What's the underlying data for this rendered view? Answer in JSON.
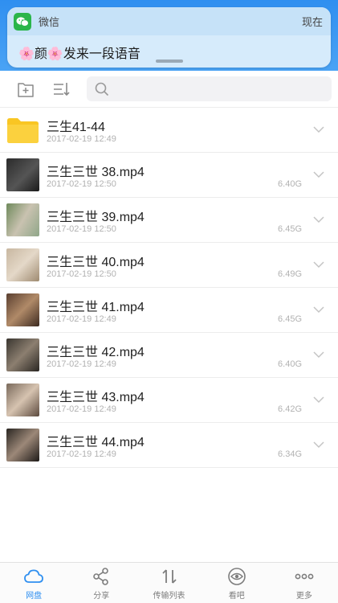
{
  "notification": {
    "app_name": "微信",
    "time": "现在",
    "message": "🌸颜🌸发来一段语音",
    "app_icon": "wechat-icon"
  },
  "toolbar": {
    "new_folder_icon": "add-folder-icon",
    "sort_icon": "sort-icon",
    "search_placeholder": ""
  },
  "files": [
    {
      "name": "三生41-44",
      "date": "2017-02-19 12:49",
      "size": "",
      "type": "folder"
    },
    {
      "name": "三生三世 38.mp4",
      "date": "2017-02-19 12:50",
      "size": "6.40G",
      "type": "video"
    },
    {
      "name": "三生三世 39.mp4",
      "date": "2017-02-19 12:50",
      "size": "6.45G",
      "type": "video"
    },
    {
      "name": "三生三世 40.mp4",
      "date": "2017-02-19 12:50",
      "size": "6.49G",
      "type": "video"
    },
    {
      "name": "三生三世 41.mp4",
      "date": "2017-02-19 12:49",
      "size": "6.45G",
      "type": "video"
    },
    {
      "name": "三生三世 42.mp4",
      "date": "2017-02-19 12:49",
      "size": "6.40G",
      "type": "video"
    },
    {
      "name": "三生三世 43.mp4",
      "date": "2017-02-19 12:49",
      "size": "6.42G",
      "type": "video"
    },
    {
      "name": "三生三世 44.mp4",
      "date": "2017-02-19 12:49",
      "size": "6.34G",
      "type": "video"
    }
  ],
  "tabs": [
    {
      "label": "网盘",
      "icon": "cloud-icon",
      "active": true
    },
    {
      "label": "分享",
      "icon": "share-icon",
      "active": false
    },
    {
      "label": "传输列表",
      "icon": "transfer-icon",
      "active": false
    },
    {
      "label": "看吧",
      "icon": "eye-icon",
      "active": false
    },
    {
      "label": "更多",
      "icon": "more-icon",
      "active": false
    }
  ],
  "colors": {
    "accent": "#2f8ff0",
    "folder": "#f9c623",
    "wechat": "#2ab54a"
  }
}
